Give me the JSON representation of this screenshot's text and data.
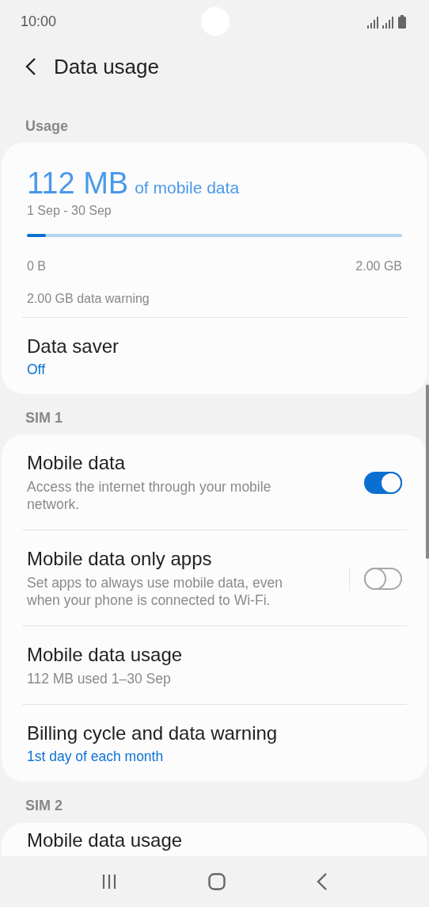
{
  "status_bar": {
    "time": "10:00"
  },
  "header": {
    "title": "Data usage"
  },
  "usage": {
    "label": "Usage",
    "amount": "112 MB",
    "amount_suffix": "of mobile data",
    "period": "1 Sep - 30 Sep",
    "level": 0.05,
    "scale_start": "0 B",
    "scale_end": "2.00 GB",
    "warning": "2.00 GB data warning",
    "data_saver": {
      "title": "Data saver",
      "value": "Off"
    }
  },
  "sim1": {
    "label": "SIM 1",
    "items": [
      {
        "kind": "toggle",
        "title": "Mobile data",
        "subtitle": "Access the internet through your mobile network.",
        "on": true
      },
      {
        "kind": "toggle",
        "title": "Mobile data only apps",
        "subtitle": "Set apps to always use mobile data, even when your phone is connected to Wi-Fi.",
        "on": false
      },
      {
        "kind": "info",
        "title": "Mobile data usage",
        "subtitle": "112 MB used 1–30 Sep"
      },
      {
        "kind": "link",
        "title": "Billing cycle and data warning",
        "subtitle": "1st day of each month"
      }
    ]
  },
  "sim2": {
    "label": "SIM 2",
    "items": [
      {
        "kind": "info",
        "title": "Mobile data usage"
      }
    ]
  }
}
